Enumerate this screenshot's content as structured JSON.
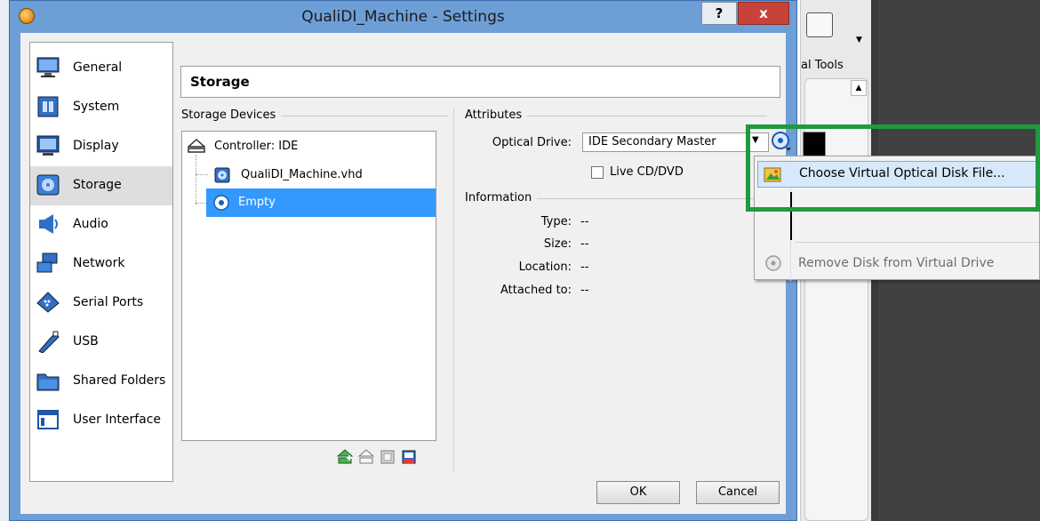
{
  "window": {
    "title": "QualiDI_Machine - Settings",
    "help_label": "?",
    "close_label": "x"
  },
  "nav": {
    "items": [
      {
        "label": "General",
        "icon": "monitor-icon"
      },
      {
        "label": "System",
        "icon": "chip-icon"
      },
      {
        "label": "Display",
        "icon": "display-icon"
      },
      {
        "label": "Storage",
        "icon": "storage-icon",
        "selected": true
      },
      {
        "label": "Audio",
        "icon": "speaker-icon"
      },
      {
        "label": "Network",
        "icon": "network-icon"
      },
      {
        "label": "Serial Ports",
        "icon": "serial-port-icon"
      },
      {
        "label": "USB",
        "icon": "usb-icon"
      },
      {
        "label": "Shared Folders",
        "icon": "folder-icon"
      },
      {
        "label": "User Interface",
        "icon": "window-icon"
      }
    ]
  },
  "page": {
    "title": "Storage"
  },
  "storage_devices": {
    "group_label": "Storage Devices",
    "controller_label": "Controller: IDE",
    "items": [
      {
        "label": "QualiDI_Machine.vhd",
        "icon": "hard-disk-icon"
      },
      {
        "label": "Empty",
        "icon": "optical-disc-icon",
        "selected": true
      }
    ]
  },
  "attributes": {
    "group_label": "Attributes",
    "optical_drive_label": "Optical Drive:",
    "optical_drive_value": "IDE Secondary Master",
    "live_cd_label": "Live CD/DVD",
    "live_cd_checked": false
  },
  "information": {
    "group_label": "Information",
    "rows": [
      {
        "label": "Type:",
        "value": "--"
      },
      {
        "label": "Size:",
        "value": "--"
      },
      {
        "label": "Location:",
        "value": "--"
      },
      {
        "label": "Attached to:",
        "value": "--"
      }
    ]
  },
  "buttons": {
    "ok": "OK",
    "cancel": "Cancel"
  },
  "popup_menu": {
    "choose_label": "Choose Virtual Optical Disk File...",
    "remove_label": "Remove Disk from Virtual Drive"
  },
  "background_app": {
    "tools_label": "al Tools"
  },
  "colors": {
    "highlight": "#1f9a3c",
    "selection": "#3399ff",
    "dialog_frame": "#6e9ed6"
  }
}
